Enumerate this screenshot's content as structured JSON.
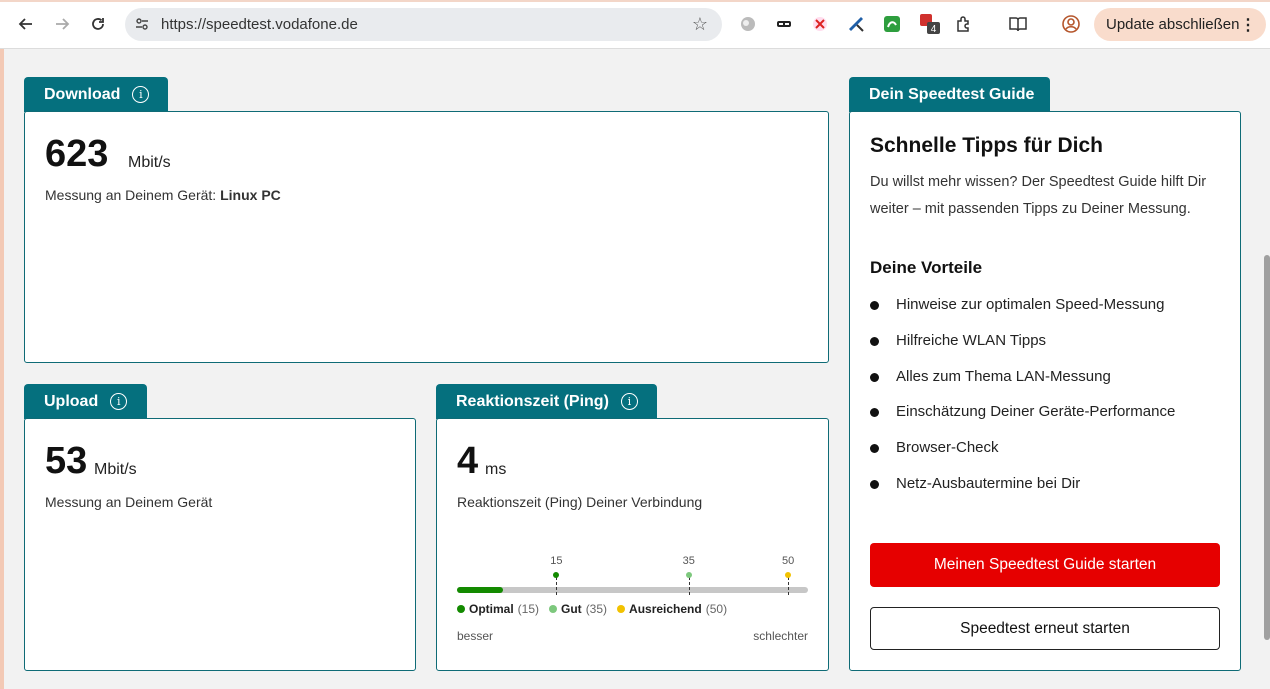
{
  "browser": {
    "url": "https://speedtest.vodafone.de",
    "update_label": "Update abschließen",
    "extension_badge": "4",
    "icons": [
      "back-icon",
      "forward-icon",
      "reload-icon",
      "site-settings-icon",
      "bookmark-star-icon",
      "extensions-icon",
      "reading-list-icon",
      "profile-icon",
      "menu-icon"
    ]
  },
  "download": {
    "tab_label": "Download",
    "value": "623",
    "unit": "Mbit/s",
    "measure_prefix": "Messung an Deinem Gerät: ",
    "device": "Linux PC"
  },
  "upload": {
    "tab_label": "Upload",
    "value": "53",
    "unit": "Mbit/s",
    "measure_text": "Messung an Deinem Gerät"
  },
  "ping": {
    "tab_label": "Reaktionszeit (Ping)",
    "value": "4",
    "unit": "ms",
    "description": "Reaktionszeit (Ping) Deiner Verbindung",
    "scale_max": 53,
    "current": 4,
    "ticks": [
      {
        "label": "15",
        "value": 15,
        "color": "#138a00"
      },
      {
        "label": "35",
        "value": 35,
        "color": "#7dc87d"
      },
      {
        "label": "50",
        "value": 50,
        "color": "#f2c200"
      }
    ],
    "legend": [
      {
        "name": "Optimal",
        "value": "(15)",
        "color": "#138a00"
      },
      {
        "name": "Gut",
        "value": "(35)",
        "color": "#7dc87d"
      },
      {
        "name": "Ausreichend",
        "value": "(50)",
        "color": "#f2c200"
      }
    ],
    "better": "besser",
    "worse": "schlechter"
  },
  "guide": {
    "tab_label": "Dein Speedtest Guide",
    "title": "Schnelle Tipps für Dich",
    "text": "Du willst mehr wissen? Der Speedtest Guide hilft Dir weiter – mit passenden Tipps zu Deiner Messung.",
    "subtitle": "Deine Vorteile",
    "benefits": [
      "Hinweise zur optimalen Speed-Messung",
      "Hilfreiche WLAN Tipps",
      "Alles zum Thema LAN-Messung",
      "Einschätzung Deiner Geräte-Performance",
      "Browser-Check",
      "Netz-Ausbautermine bei Dir"
    ],
    "primary_button": "Meinen Speedtest Guide starten",
    "secondary_button": "Speedtest erneut starten"
  },
  "colors": {
    "teal": "#05707e",
    "red": "#e60000"
  }
}
